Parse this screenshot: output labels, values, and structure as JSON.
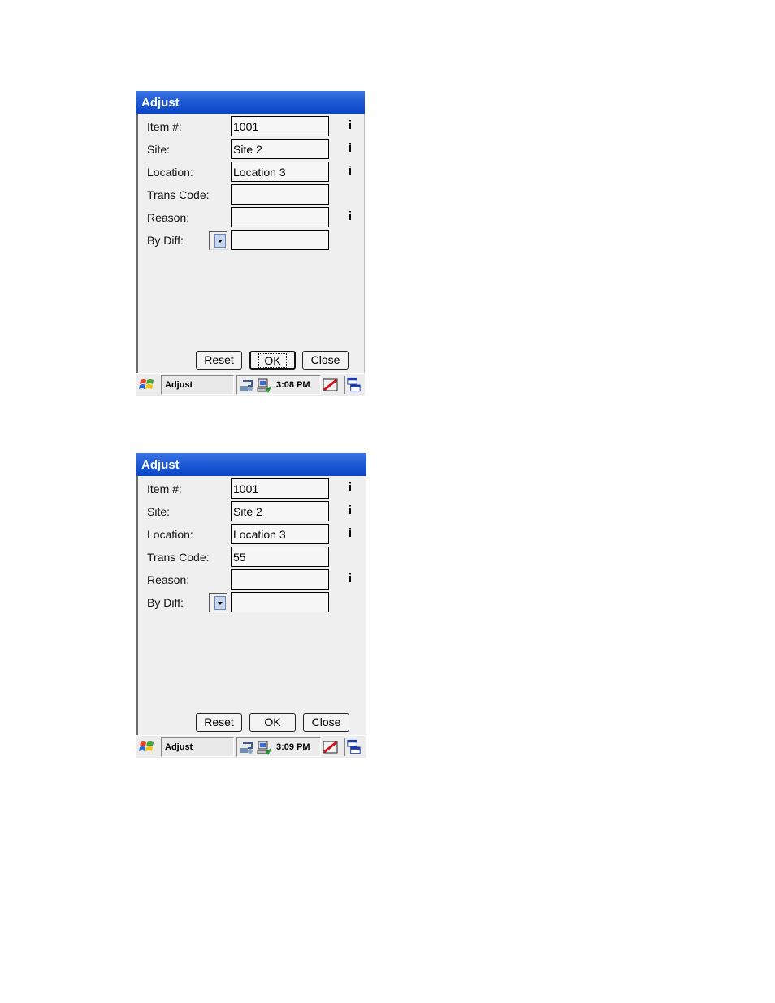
{
  "screens": [
    {
      "title": "Adjust",
      "labels": {
        "item": "Item #:",
        "site": "Site:",
        "location": "Location:",
        "trans_code": "Trans Code:",
        "reason": "Reason:",
        "by_diff": "By Diff:"
      },
      "values": {
        "item": "1001",
        "site": "Site 2",
        "location": "Location 3",
        "trans_code": "",
        "reason": "",
        "by_diff": ""
      },
      "info_glyph": "i",
      "buttons": {
        "reset": "Reset",
        "ok": "OK",
        "close": "Close"
      },
      "taskbar": {
        "task": "Adjust",
        "time": "3:08 PM"
      }
    },
    {
      "title": "Adjust",
      "labels": {
        "item": "Item #:",
        "site": "Site:",
        "location": "Location:",
        "trans_code": "Trans Code:",
        "reason": "Reason:",
        "by_diff": "By Diff:"
      },
      "values": {
        "item": "1001",
        "site": "Site 2",
        "location": "Location 3",
        "trans_code": "55",
        "reason": "",
        "by_diff": ""
      },
      "info_glyph": "i",
      "buttons": {
        "reset": "Reset",
        "ok": "OK",
        "close": "Close"
      },
      "taskbar": {
        "task": "Adjust",
        "time": "3:09 PM"
      }
    }
  ],
  "icons": {
    "start": "windows-start-icon",
    "network": "network-icon",
    "computer": "computer-icon",
    "keyboard": "input-panel-icon",
    "windows": "window-list-icon"
  },
  "colors": {
    "titlebar": "#1f5bd6",
    "window_bg": "#efefef"
  }
}
